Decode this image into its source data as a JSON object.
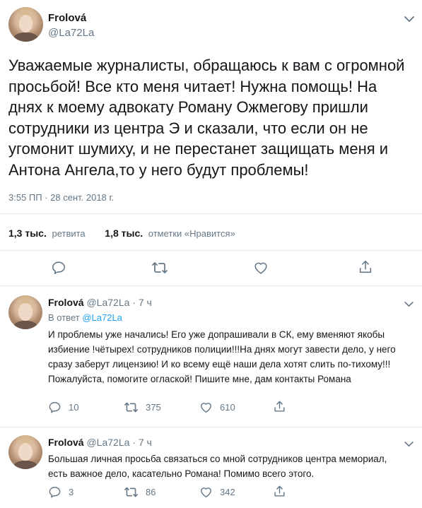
{
  "main_tweet": {
    "author_name": "Frolová",
    "author_handle": "@La72La",
    "text": "Уважаемые журналисты, обращаюсь к вам с огромной просьбой! Все кто меня читает! Нужна помощь! На днях к моему адвокату Роману Ожмегову пришли сотрудники из центра Э и сказали, что если он не угомонит шумиху, и не перестанет защищать меня и Антона Ангела,то у него будут проблемы!",
    "timestamp": "3:55 ПП · 28 сент. 2018 г.",
    "retweets_count": "1,3 тыс.",
    "retweets_label": "ретвита",
    "likes_count": "1,8 тыс.",
    "likes_label": "отметки «Нравится»"
  },
  "replies": [
    {
      "author_name": "Frolová",
      "author_handle": "@La72La",
      "time": "· 7 ч",
      "reply_to_label": "В ответ",
      "reply_to_handle": "@La72La",
      "text": "И проблемы уже начались! Его уже допрашивали в СК, ему вменяют якобы избиение !чётырех! сотрудников полиции!!!На днях могут завести дело, у него сразу заберут лицензию! И ко всему ещё наши дела хотят слить по-тихому!!! Пожалуйста, помогите оглаской! Пишите мне, дам контакты Романа",
      "replies": "10",
      "retweets": "375",
      "likes": "610"
    },
    {
      "author_name": "Frolová",
      "author_handle": "@La72La",
      "time": "· 7 ч",
      "text": "Большая личная просьба связаться со мной сотрудников центра мемориал, есть важное дело, касательно Романа! Помимо всего этого.",
      "replies": "3",
      "retweets": "86",
      "likes": "342"
    }
  ],
  "icons": {
    "reply": "reply-icon",
    "retweet": "retweet-icon",
    "like": "heart-icon",
    "share": "share-icon",
    "menu": "chevron-down-icon"
  },
  "colors": {
    "text": "#14171a",
    "secondary": "#657786",
    "link": "#1da1f2",
    "divider": "#e6ecf0"
  }
}
